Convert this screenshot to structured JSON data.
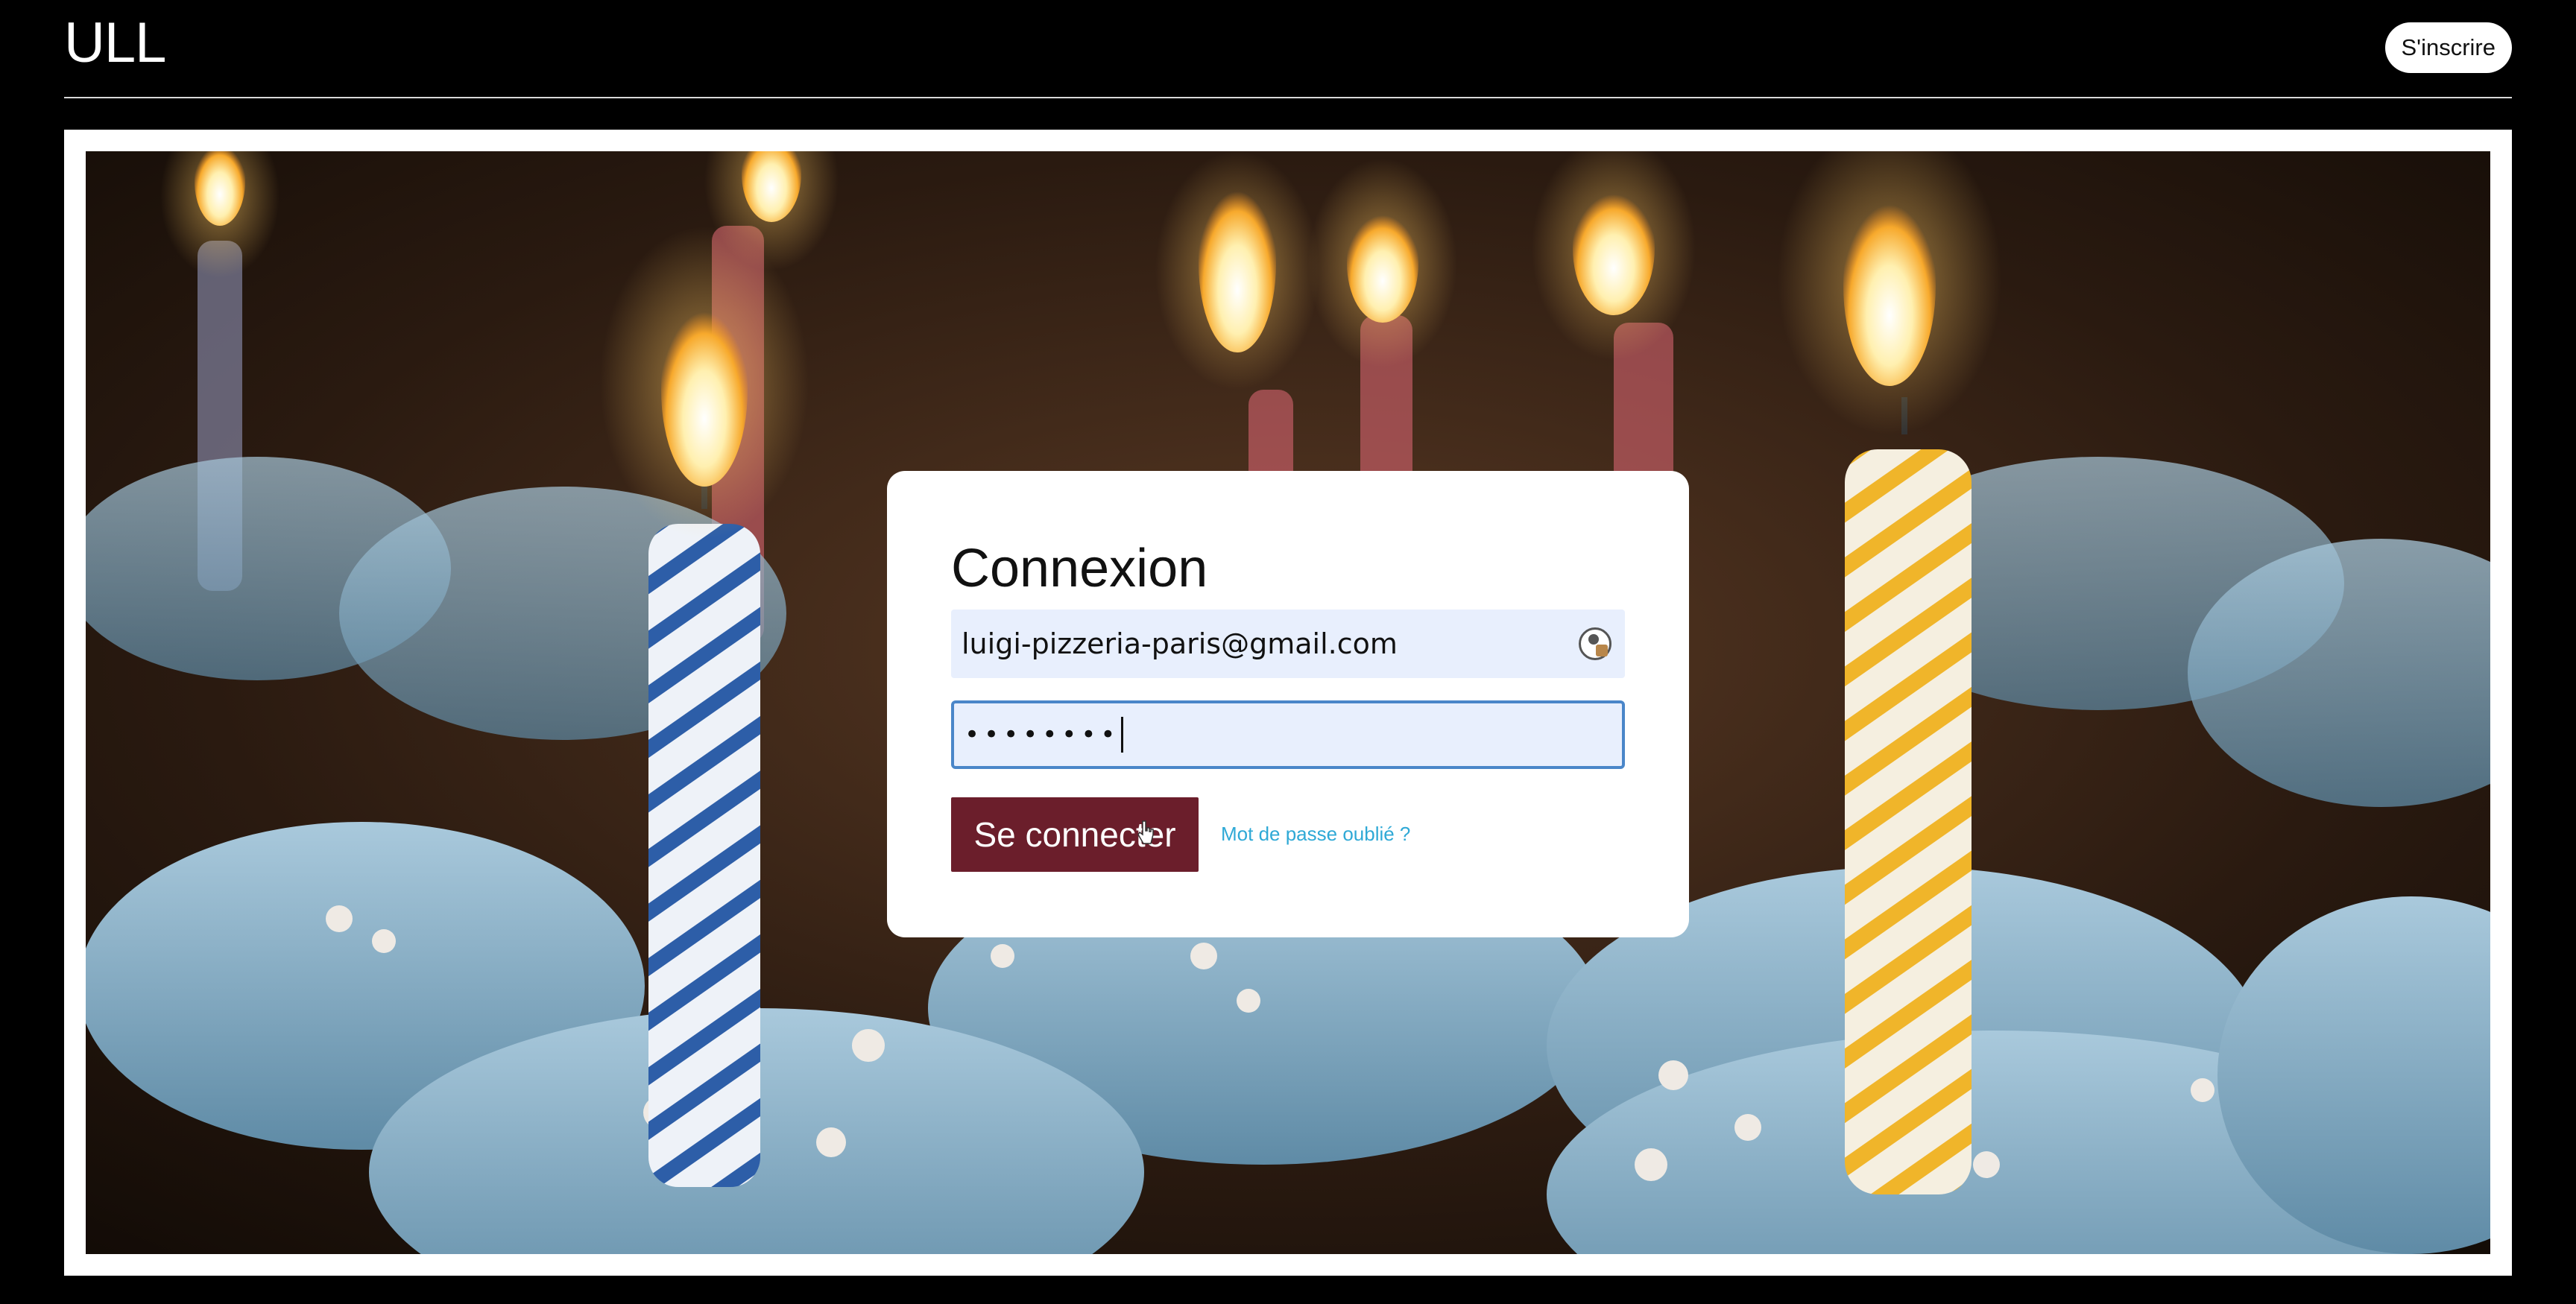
{
  "header": {
    "logo": "ULL",
    "signup_label": "S'inscrire"
  },
  "hero": {
    "image_icon": "birthday-candles-image"
  },
  "login": {
    "title": "Connexion",
    "email_value": "luigi-pizzeria-paris@gmail.com",
    "password_masked": "••••••••",
    "submit_label": "Se connecter",
    "forgot_label": "Mot de passe oublié ?"
  },
  "colors": {
    "accent": "#6b1e2b",
    "link": "#2fa9d6",
    "field_bg": "#e8effd",
    "focus_border": "#4a86c9"
  }
}
